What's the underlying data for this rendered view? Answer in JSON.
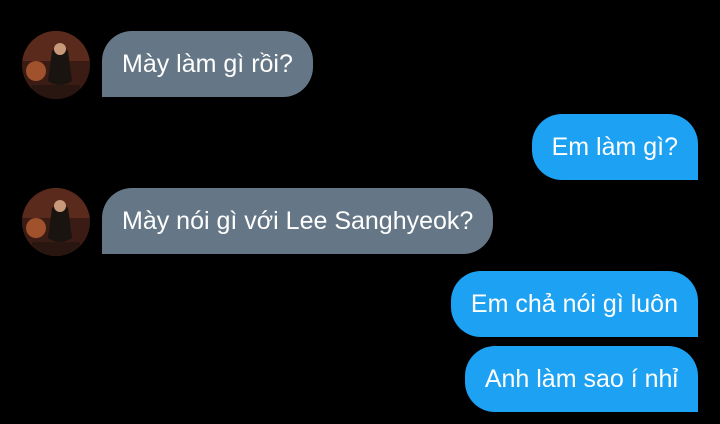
{
  "colors": {
    "background": "#000000",
    "incoming_bubble": "#657786",
    "outgoing_bubble": "#1da1f2",
    "text": "#ffffff"
  },
  "avatar_icon": "user-avatar-photo-icon",
  "messages": [
    {
      "direction": "incoming",
      "text": "Mày làm gì rồi?"
    },
    {
      "direction": "outgoing",
      "text": "Em làm gì?"
    },
    {
      "direction": "incoming",
      "text": "Mày nói gì với Lee Sanghyeok?"
    },
    {
      "direction": "outgoing",
      "text": "Em chả nói gì luôn"
    },
    {
      "direction": "outgoing",
      "text": "Anh làm sao í nhỉ"
    }
  ]
}
